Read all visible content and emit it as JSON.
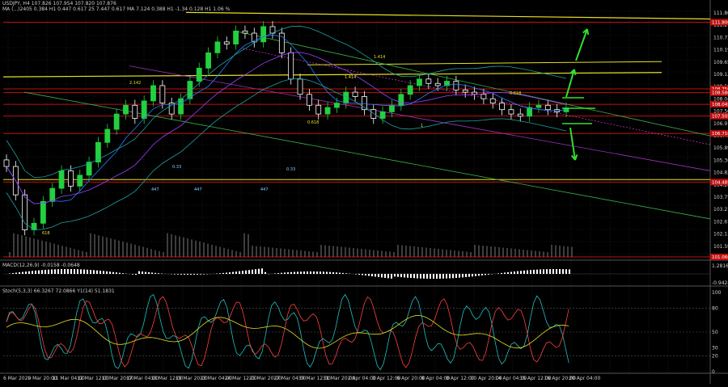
{
  "header": {
    "symbol_line": "USDJPY, H4  107.826 107.954 107.820 107.876",
    "ma_line": "MA (...)2405  0.384  H1 0.447  0.617  25 7.447  0.617  MA 7.124  0.388  H1 -1.34  0.128  H1 1.06 %",
    "macd_label": "MACD(12,26,9) -0.0158 -0.0648",
    "stoch_label": "Stoch(5,3,3) 66.3267 72.0866 Y1(14) 51.1831"
  },
  "price_axis": [
    "111.800",
    "111.270",
    "110.730",
    "110.195",
    "109.655",
    "109.120",
    "108.580",
    "108.045",
    "107.505",
    "106.970",
    "106.430",
    "105.895",
    "105.360",
    "104.820",
    "104.285",
    "103.750",
    "103.210",
    "102.670",
    "102.135",
    "101.595",
    "101.060"
  ],
  "macd_axis": [
    "1.2816",
    "-0.9424"
  ],
  "stoch_axis": [
    "100",
    "80",
    "50",
    "30",
    "20",
    "0"
  ],
  "time_axis": [
    "6 Mar 2020",
    "9 Mar 20:00",
    "11 Mar 04:00",
    "12 Mar 12:00",
    "13 Mar 20:00",
    "17 Mar 04:00",
    "18 Mar 12:00",
    "19 Mar 20:00",
    "23 Mar 04:00",
    "24 Mar 12:00",
    "25 Mar 20:00",
    "27 Mar 04:00",
    "30 Mar 12:00",
    "31 Mar 20:00",
    "2 Apr 04:00",
    "3 Apr 12:00",
    "6 Apr 20:00",
    "8 Apr 04:00",
    "9 Apr 12:00",
    "10 Apr 20:00",
    "14 Apr 04:00",
    "15 Apr 12:00",
    "16 Apr 20:00",
    "20 Apr 04:00"
  ],
  "level_tags": [
    {
      "price": "111.800",
      "color": "#c01010"
    },
    {
      "price": "108.750",
      "color": "#c01010"
    },
    {
      "price": "108.580",
      "color": "#c01010"
    },
    {
      "price": "108.045",
      "color": "#c01010"
    },
    {
      "price": "107.505",
      "color": "#c01010"
    },
    {
      "price": "106.710",
      "color": "#c01010"
    },
    {
      "price": "104.485",
      "color": "#c01010"
    },
    {
      "price": "101.060",
      "color": "#c01010"
    }
  ],
  "annotations": [
    "2.142",
    "1.414",
    "1.414",
    "1",
    "0.618",
    "0.33",
    "0.33",
    "447",
    "447",
    "447",
    "618",
    "0.618"
  ],
  "colors": {
    "bull": "#22d040",
    "bear": "#ffffff",
    "support": "#c01010",
    "trend": "#e8e020",
    "arrow": "#30e030",
    "macd": "#ffffff",
    "stoch_main": "#22c0c0",
    "stoch_sig": "#ff4040",
    "stoch_alt": "#e8e020"
  },
  "chart_data": {
    "type": "candlestick",
    "symbol": "USDJPY",
    "timeframe": "H4",
    "ylim": [
      101.06,
      112.3
    ],
    "candles_close": [
      105.2,
      103.9,
      102.3,
      102.6,
      103.6,
      104.2,
      105.0,
      104.3,
      104.8,
      105.4,
      106.3,
      106.9,
      107.6,
      108.0,
      107.4,
      108.2,
      108.9,
      108.1,
      107.6,
      108.3,
      109.1,
      109.7,
      110.4,
      110.9,
      110.8,
      111.4,
      111.3,
      110.9,
      111.6,
      111.3,
      110.4,
      109.2,
      108.5,
      108.0,
      107.6,
      107.9,
      108.1,
      108.6,
      108.4,
      107.8,
      107.4,
      107.7,
      108.0,
      108.5,
      108.9,
      109.2,
      109.0,
      108.9,
      109.1,
      108.7,
      108.6,
      108.5,
      108.3,
      108.1,
      107.8,
      107.6,
      107.5,
      107.9,
      108.0,
      107.8,
      107.7,
      107.88
    ],
    "levels_red": [
      111.8,
      108.75,
      108.58,
      108.045,
      107.505,
      106.71,
      104.485,
      101.06
    ],
    "levels_yellow": [
      109.3,
      104.6
    ],
    "forecast": [
      "up",
      "up",
      "down"
    ],
    "macd_range": [
      -0.9424,
      1.2816
    ],
    "stoch_range": [
      0,
      100
    ]
  }
}
